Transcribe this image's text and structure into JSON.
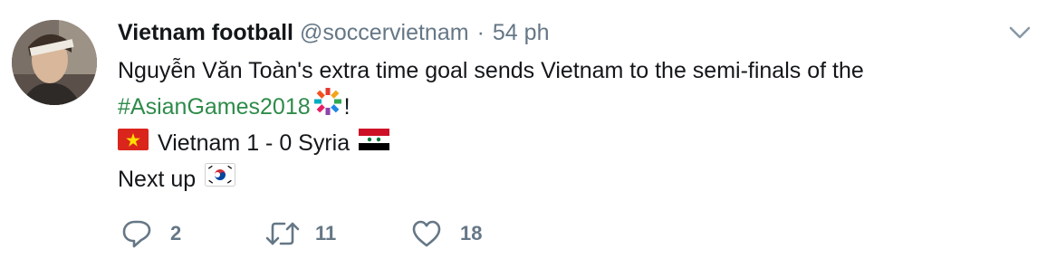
{
  "tweet": {
    "display_name": "Vietnam football",
    "handle": "@soccervietnam",
    "separator": "·",
    "time": "54 ph",
    "text": {
      "line1": "Nguyễn Văn Toàn's extra time goal sends Vietnam to the semi-finals of the",
      "hashtag": "#AsianGames2018",
      "exclamation": "!",
      "score": "Vietnam 1 - 0 Syria",
      "next_up": "Next up"
    },
    "actions": {
      "replies": "2",
      "retweets": "11",
      "likes": "18"
    },
    "icons": {
      "reply": "reply-icon",
      "retweet": "retweet-icon",
      "like": "heart-icon",
      "menu": "chevron-down-icon"
    },
    "colors": {
      "hashtag": "#2e8b4a",
      "secondary_text": "#657786",
      "primary_text": "#14171a"
    }
  }
}
